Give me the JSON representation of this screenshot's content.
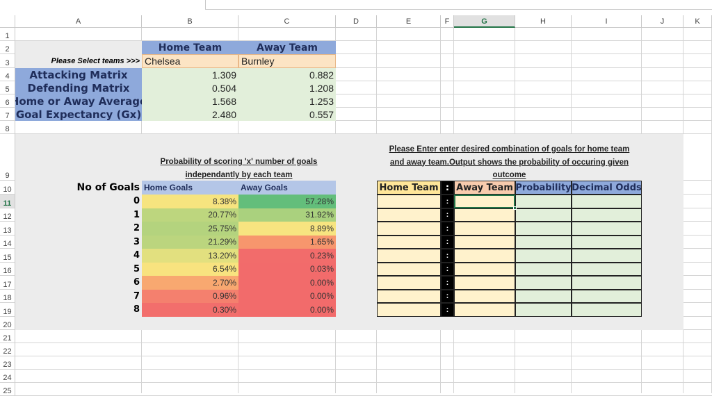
{
  "columns": [
    "A",
    "B",
    "C",
    "D",
    "E",
    "F",
    "G",
    "H",
    "I",
    "J",
    "K"
  ],
  "rows": [
    "1",
    "2",
    "3",
    "4",
    "5",
    "6",
    "7",
    "8",
    "9",
    "10",
    "11",
    "12",
    "13",
    "14",
    "15",
    "16",
    "17",
    "18",
    "19",
    "20",
    "21",
    "22",
    "23",
    "24",
    "25"
  ],
  "selected_cell": "G11",
  "team_selector": {
    "prompt": "Please Select teams >>>",
    "home_header": "Home Team",
    "away_header": "Away Team",
    "home_team": "Chelsea",
    "away_team": "Burnley"
  },
  "metrics": [
    {
      "label": "Attacking Matrix",
      "home": "1.309",
      "away": "0.882"
    },
    {
      "label": "Defending Matrix",
      "home": "0.504",
      "away": "1.208"
    },
    {
      "label": "Home or Away Average",
      "home": "1.568",
      "away": "1.253"
    },
    {
      "label": "Goal Expectancy (Gx)",
      "home": "2.480",
      "away": "0.557"
    }
  ],
  "probability_table": {
    "title_line1": "Probability of scoring 'x' number of goals",
    "title_line2": "independantly by each team",
    "goals_header": "No of Goals",
    "home_header": "Home Goals",
    "away_header": "Away Goals",
    "rows": [
      {
        "goals": "0",
        "home": "8.38%",
        "away": "57.28%",
        "home_color": "#f6e47f",
        "away_color": "#63be7b"
      },
      {
        "goals": "1",
        "home": "20.77%",
        "away": "31.92%",
        "home_color": "#bdd67e",
        "away_color": "#aad17e"
      },
      {
        "goals": "2",
        "home": "25.75%",
        "away": "8.89%",
        "home_color": "#b4d37e",
        "away_color": "#f7e480"
      },
      {
        "goals": "3",
        "home": "21.29%",
        "away": "1.65%",
        "home_color": "#bbd57e",
        "away_color": "#f7966d"
      },
      {
        "goals": "4",
        "home": "13.20%",
        "away": "0.23%",
        "home_color": "#e2e07f",
        "away_color": "#f26c6b"
      },
      {
        "goals": "5",
        "home": "6.54%",
        "away": "0.03%",
        "home_color": "#f8e37f",
        "away_color": "#f26b6b"
      },
      {
        "goals": "6",
        "home": "2.70%",
        "away": "0.00%",
        "home_color": "#f8a870",
        "away_color": "#f26b6b"
      },
      {
        "goals": "7",
        "home": "0.96%",
        "away": "0.00%",
        "home_color": "#f4806e",
        "away_color": "#f26b6b"
      },
      {
        "goals": "8",
        "home": "0.30%",
        "away": "0.00%",
        "home_color": "#f26e6c",
        "away_color": "#f26b6b"
      }
    ]
  },
  "combination_table": {
    "title_line1": "Please Enter enter desired combination of goals for home team",
    "title_line2": "and away team.Output shows the probability of occuring given",
    "title_line3": "outcome",
    "headers": {
      "home": "Home Team",
      "sep": ":",
      "away": "Away Team",
      "probability": "Probability",
      "odds": "Decimal Odds"
    },
    "separator": ":",
    "row_count": 9
  }
}
